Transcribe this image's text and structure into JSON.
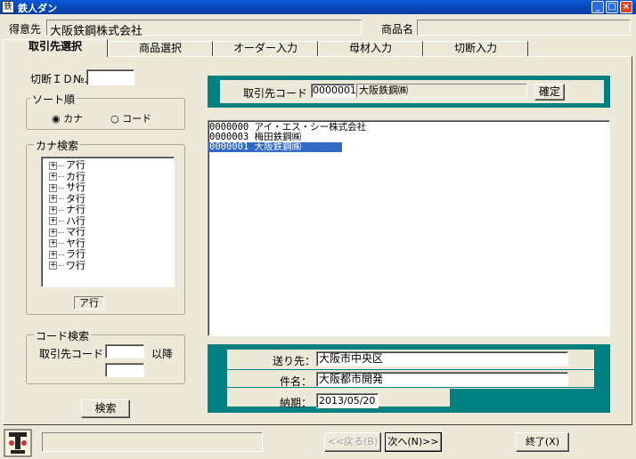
{
  "window": {
    "title": "鉄人ダン",
    "app_icon": "鉄"
  },
  "header": {
    "customer_label": "得意先",
    "customer_value": "大阪鉄鋼株式会社",
    "product_label": "商品名",
    "product_value": ""
  },
  "tabs": [
    {
      "label": "取引先選択",
      "active": true
    },
    {
      "label": "商品選択",
      "active": false
    },
    {
      "label": "オーダー入力",
      "active": false
    },
    {
      "label": "母材入力",
      "active": false
    },
    {
      "label": "切断入力",
      "active": false
    }
  ],
  "left": {
    "cut_id_label": "切断ＩＤ№.",
    "cut_id_value": "",
    "sort": {
      "title": "ソート順",
      "option_kana": "カナ",
      "option_code": "コード",
      "selected": "カナ"
    },
    "kana_search": {
      "title": "カナ検索",
      "items": [
        "ア行",
        "カ行",
        "サ行",
        "タ行",
        "ナ行",
        "ハ行",
        "マ行",
        "ヤ行",
        "ラ行",
        "ワ行"
      ],
      "selected_label": "ア行"
    },
    "code_search": {
      "title": "コード検索",
      "code_label": "取引先コード",
      "from_value": "",
      "after_label": "以降",
      "to_value": ""
    },
    "search_button": "検索"
  },
  "client_code": {
    "label": "取引先コード",
    "code_value": "0000001",
    "name_value": "大阪鉄鋼㈱",
    "confirm_button": "確定"
  },
  "client_list": [
    {
      "code": "0000000",
      "name": "アイ・エス・シー株式会社",
      "selected": false
    },
    {
      "code": "0000003",
      "name": "梅田鉄鋼㈱",
      "selected": false
    },
    {
      "code": "0000001",
      "name": "大阪鉄鋼㈱",
      "selected": true
    }
  ],
  "details": {
    "destination_label": "送り先：",
    "destination_value": "大阪市中央区",
    "subject_label": "件名：",
    "subject_value": "大阪都市開発",
    "due_label": "納期：",
    "due_value": "2013/05/20"
  },
  "footer": {
    "status_text": "",
    "back_button": "<<戻る(B)",
    "next_button": "次へ(N)>>",
    "exit_button": "終了(X)"
  }
}
